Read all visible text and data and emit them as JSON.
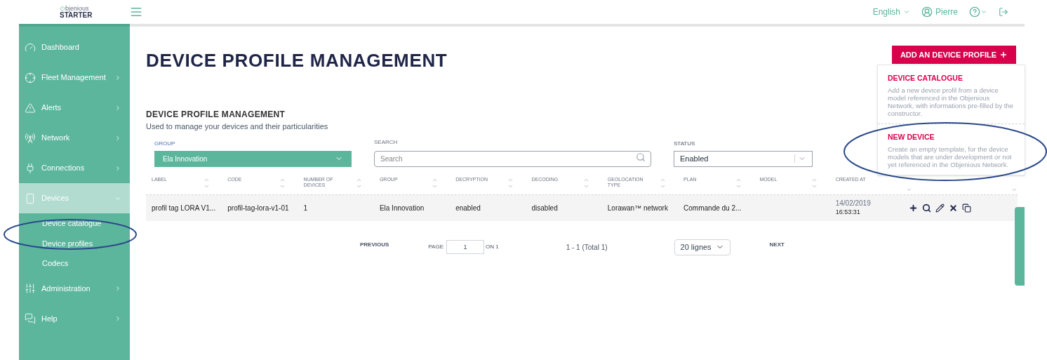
{
  "header": {
    "logo_top": "bjenious",
    "logo_bottom": "STARTER",
    "language": "English",
    "user": "Pierre"
  },
  "sidebar": {
    "items": [
      {
        "label": "Dashboard",
        "selected": false
      },
      {
        "label": "Fleet Management",
        "selected": false,
        "expanded": false
      },
      {
        "label": "Alerts",
        "selected": false,
        "expanded": false
      },
      {
        "label": "Network",
        "selected": false,
        "expanded": false
      },
      {
        "label": "Connections",
        "selected": false,
        "expanded": false
      },
      {
        "label": "Devices",
        "selected": true,
        "expanded": true,
        "children": [
          {
            "label": "Device catalogue"
          },
          {
            "label": "Device profiles"
          },
          {
            "label": "Codecs"
          }
        ]
      },
      {
        "label": "Administration",
        "selected": false,
        "expanded": false
      },
      {
        "label": "Help",
        "selected": false,
        "expanded": false
      }
    ]
  },
  "page_title": "DEVICE PROFILE MANAGEMENT",
  "add_button": {
    "label": "ADD AN DEVICE PROFILE",
    "menu": [
      {
        "title": "DEVICE CATALOGUE",
        "description": "Add a new device profil from a device model referenced in the Objenious Network, with informations pre-filled by the constructor."
      },
      {
        "title": "NEW DEVICE",
        "description": "Create an empty template, for the device models that are under development or not yet referenced in the Objenious Network."
      }
    ]
  },
  "section": {
    "title": "DEVICE PROFILE MANAGEMENT",
    "subtitle": "Used to manage your devices and their particularities"
  },
  "filters": {
    "group": {
      "label": "GROUP",
      "value": "Ela Innovation"
    },
    "search": {
      "label": "SEARCH",
      "placeholder": "Search"
    },
    "status": {
      "label": "STATUS",
      "value": "Enabled"
    }
  },
  "table": {
    "columns": [
      "LABEL",
      "CODE",
      "NUMBER OF DEVICES",
      "GROUP",
      "DECRYPTION",
      "DECODING",
      "GEOLOCATION TYPE",
      "PLAN",
      "MODEL",
      "CREATED AT"
    ],
    "rows": [
      {
        "cells": [
          "profil tag LORA V1...",
          "profil-tag-lora-v1-01",
          "1",
          "Ela Innovation",
          "enabled",
          "disabled",
          "Lorawan™ network",
          "Commande du 2...",
          ""
        ],
        "created_date": "14/02/2019",
        "created_time": "16:53:31"
      }
    ]
  },
  "pagination": {
    "previous": "PREVIOUS",
    "page_label": "PAGE",
    "page": "1",
    "of": "ON 1",
    "range": "1 - 1 (Total 1)",
    "per_page": "20 lignes",
    "next": "NEXT"
  }
}
